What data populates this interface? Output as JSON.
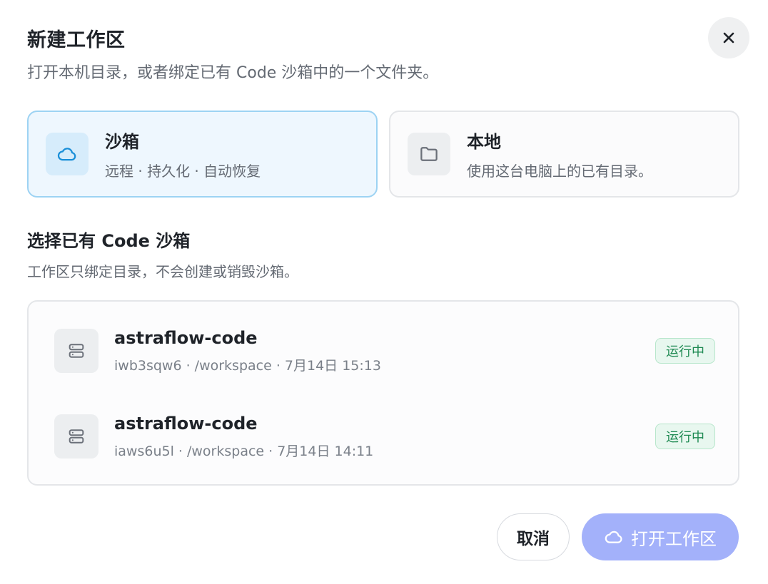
{
  "dialog": {
    "title": "新建工作区",
    "subtitle": "打开本机目录，或者绑定已有 Code 沙箱中的一个文件夹。",
    "close_icon": "close-icon"
  },
  "modes": [
    {
      "title": "沙箱",
      "description": "远程 · 持久化 · 自动恢复",
      "icon": "cloud-icon",
      "selected": true
    },
    {
      "title": "本地",
      "description": "使用这台电脑上的已有目录。",
      "icon": "folder-icon",
      "selected": false
    }
  ],
  "sandbox_section": {
    "title": "选择已有 Code 沙箱",
    "description": "工作区只绑定目录，不会创建或销毁沙箱。",
    "items": [
      {
        "name": "astraflow-code",
        "meta": "iwb3sqw6 · /workspace · 7月14日 15:13",
        "status": "运行中",
        "icon": "server-icon"
      },
      {
        "name": "astraflow-code",
        "meta": "iaws6u5l · /workspace · 7月14日 14:11",
        "status": "运行中",
        "icon": "server-icon"
      }
    ]
  },
  "footer": {
    "cancel_label": "取消",
    "open_label": "打开工作区",
    "open_icon": "cloud-icon"
  },
  "colors": {
    "accent_selected_border": "#9dd3f3",
    "accent_selected_bg": "#eef7fe",
    "status_running": "#1e8a52",
    "primary_button": "#a3b1fa"
  }
}
